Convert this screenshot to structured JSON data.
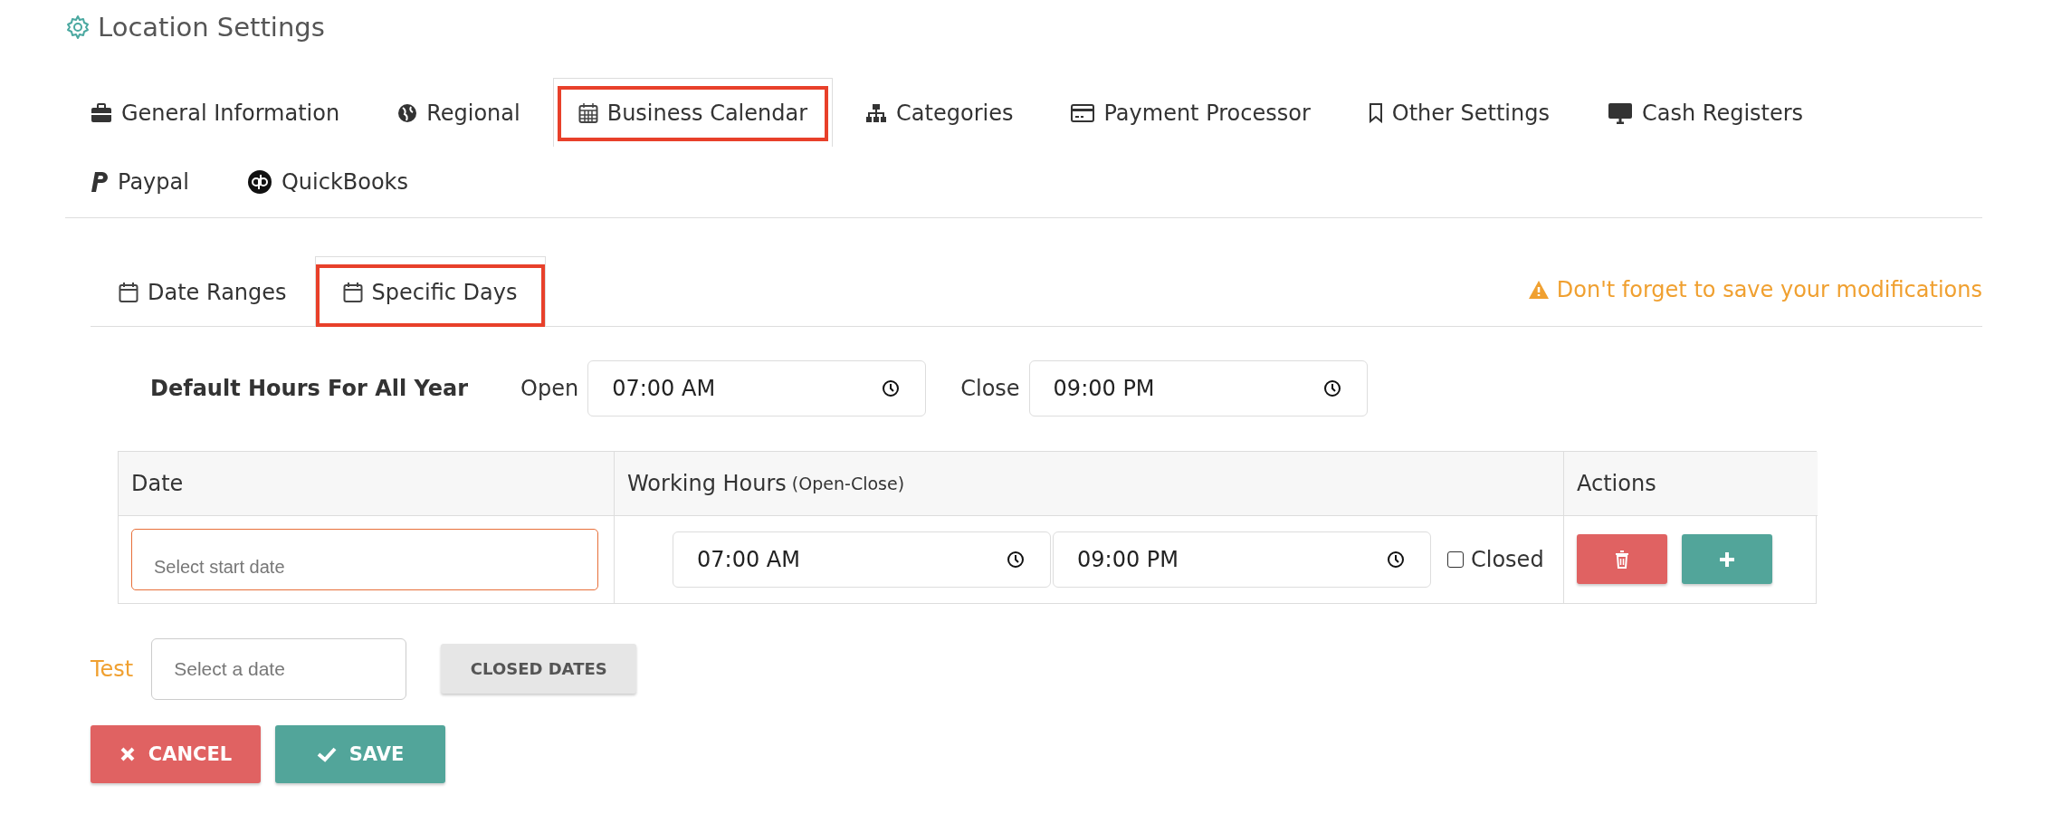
{
  "page": {
    "title": "Location Settings"
  },
  "tabs": [
    {
      "label": "General Information",
      "selected": false,
      "highlighted": false
    },
    {
      "label": "Regional",
      "selected": false,
      "highlighted": false
    },
    {
      "label": "Business Calendar",
      "selected": true,
      "highlighted": true
    },
    {
      "label": "Categories",
      "selected": false,
      "highlighted": false
    },
    {
      "label": "Payment Processor",
      "selected": false,
      "highlighted": false
    },
    {
      "label": "Other Settings",
      "selected": false,
      "highlighted": false
    },
    {
      "label": "Cash Registers",
      "selected": false,
      "highlighted": false
    },
    {
      "label": "Paypal",
      "selected": false,
      "highlighted": false
    },
    {
      "label": "QuickBooks",
      "selected": false,
      "highlighted": false
    }
  ],
  "subtabs": [
    {
      "label": "Date Ranges",
      "selected": false,
      "highlighted": false
    },
    {
      "label": "Specific Days",
      "selected": true,
      "highlighted": true
    }
  ],
  "warning": "Don't forget to save your modifications",
  "default_hours": {
    "label": "Default Hours For All Year",
    "open_label": "Open",
    "open_value": "07:00 AM",
    "close_label": "Close",
    "close_value": "09:00 PM"
  },
  "table": {
    "columns": [
      {
        "label": "Date"
      },
      {
        "label": "Working Hours",
        "note": "(Open-Close)"
      },
      {
        "label": "Actions"
      }
    ],
    "rows": [
      {
        "date_placeholder": "Select start date",
        "open": "07:00 AM",
        "close": "09:00 PM",
        "closed_label": "Closed",
        "closed": false
      }
    ]
  },
  "test": {
    "label": "Test",
    "placeholder": "Select a date",
    "button": "CLOSED DATES"
  },
  "buttons": [
    {
      "label": "CANCEL",
      "kind": "cancel"
    },
    {
      "label": "SAVE",
      "kind": "save"
    }
  ]
}
